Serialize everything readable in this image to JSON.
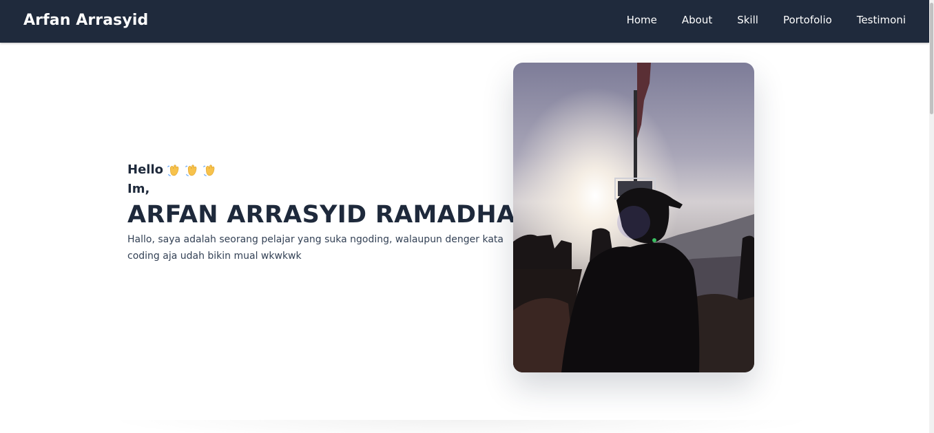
{
  "header": {
    "brand": "Arfan Arrasyid",
    "nav": [
      {
        "label": "Home"
      },
      {
        "label": "About"
      },
      {
        "label": "Skill"
      },
      {
        "label": "Portofolio"
      },
      {
        "label": "Testimoni"
      }
    ]
  },
  "hero": {
    "greeting": "Hello",
    "greeting_icons": [
      "waving-hand-icon",
      "waving-hand-icon",
      "waving-hand-icon"
    ],
    "intro": "Im,",
    "name": "ARFAN ARRASYID RAMADHAN",
    "description": "Hallo, saya adalah seorang pelajar yang suka ngoding, walaupun denger kata coding aja udah bikin mual wkwkwk"
  },
  "colors": {
    "navbar_bg": "#1f2a3c",
    "text_primary": "#1e293b",
    "text_secondary": "#334155",
    "background": "#ffffff"
  }
}
